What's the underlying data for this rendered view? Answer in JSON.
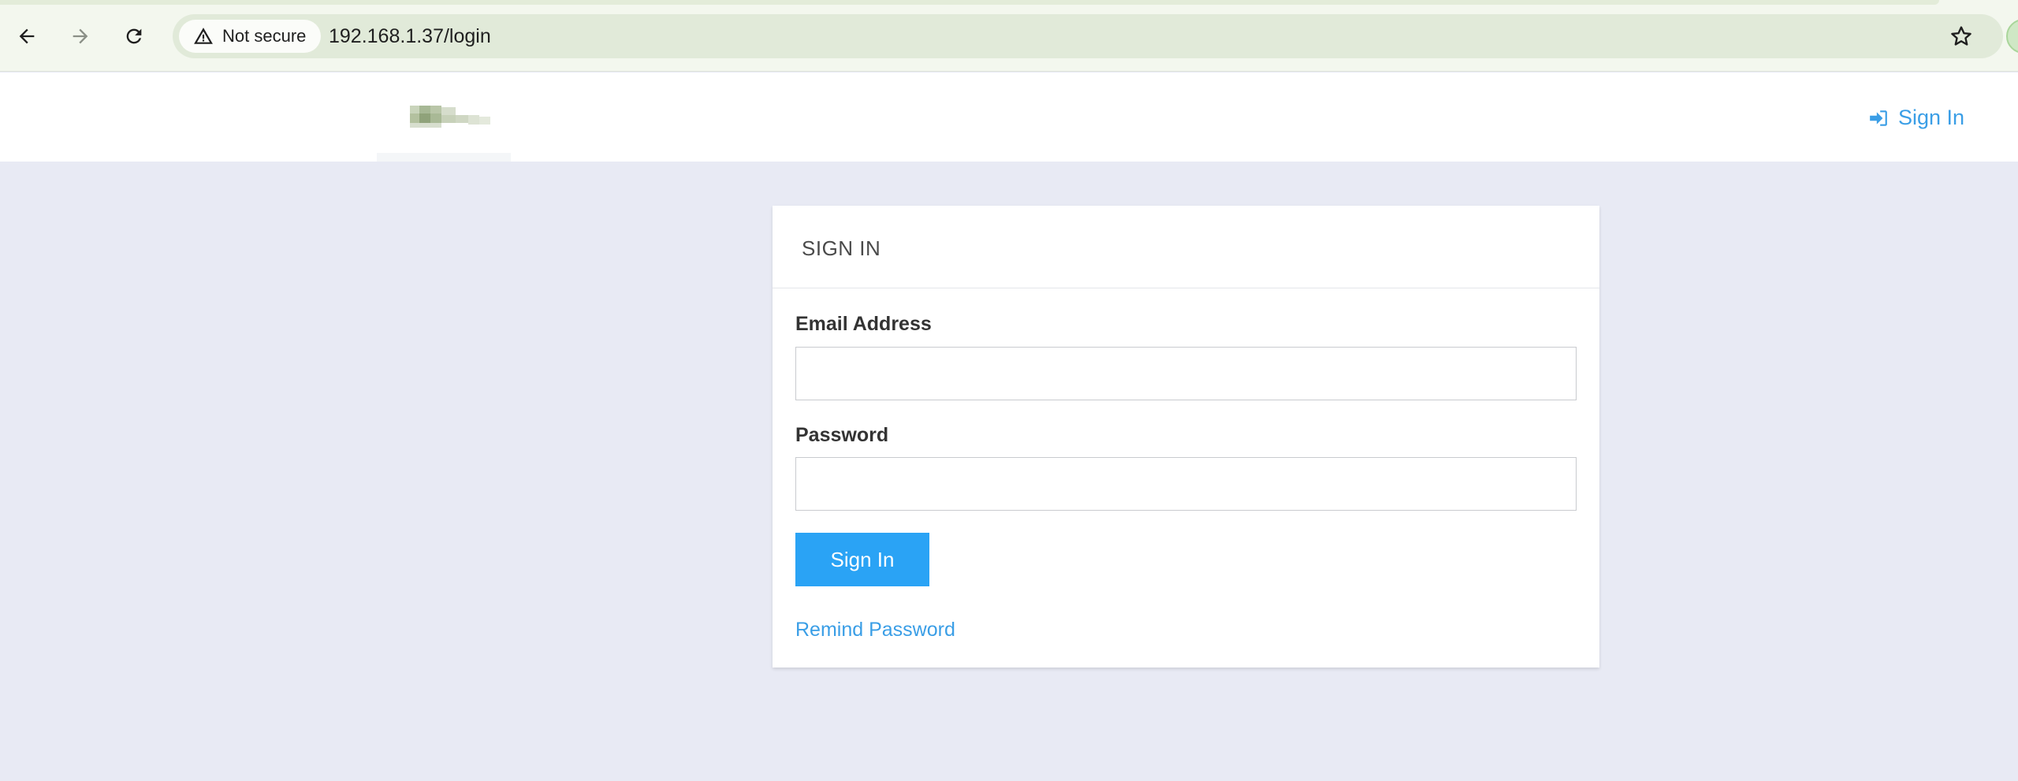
{
  "browser": {
    "security_label": "Not secure",
    "url": "192.168.1.37/login",
    "icons": [
      "back-arrow-icon",
      "forward-arrow-icon",
      "reload-icon",
      "warning-icon",
      "bookmark-star-icon"
    ]
  },
  "header": {
    "signin_label": "Sign In",
    "signin_icon": "sign-in-icon",
    "link_color": "#3a9ee6"
  },
  "login": {
    "title": "SIGN IN",
    "email_label": "Email Address",
    "email_value": "",
    "password_label": "Password",
    "password_value": "",
    "submit_label": "Sign In",
    "remind_label": "Remind Password",
    "button_color": "#2aa3f5"
  },
  "colors": {
    "page_background": "#e8eaf4",
    "header_background": "#ffffff"
  }
}
